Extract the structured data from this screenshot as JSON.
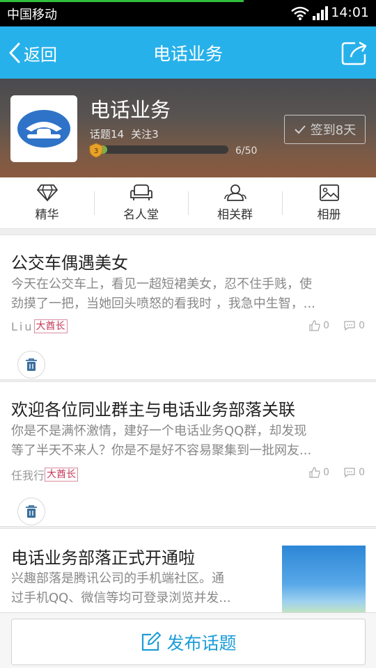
{
  "status_bar": {
    "carrier": "中国移动",
    "time": "14:01"
  },
  "nav": {
    "back_label": "返回",
    "title": "电话业务"
  },
  "header": {
    "name": "电话业务",
    "topics": "话题14",
    "follows": "关注3",
    "level": "3",
    "level_progress_text": "6/50",
    "level_progress": 0.12,
    "checkin_label": "签到8天"
  },
  "tabs": [
    {
      "label": "精华",
      "icon": "diamond-icon"
    },
    {
      "label": "名人堂",
      "icon": "sofa-icon"
    },
    {
      "label": "相关群",
      "icon": "group-icon"
    },
    {
      "label": "相册",
      "icon": "image-icon"
    }
  ],
  "posts": [
    {
      "title": "公交车偶遇美女",
      "body_line1": "今天在公交车上，看见一超短裙美女，忍不住手贱，使",
      "body_line2": "劲摸了一把，当她回头喷怒的看我时 ，我急中生智，...",
      "author": "Liu",
      "rank": "大酋长",
      "likes": "0",
      "comments": "0"
    },
    {
      "title": "欢迎各位同业群主与电话业务部落关联",
      "body_line1": "你是不是满怀激情，建好一个电话业务QQ群，却发现",
      "body_line2": "等了半天不来人？你是不是好不容易聚集到一批网友...",
      "author": "任我行",
      "rank": "大酋长",
      "likes": "0",
      "comments": "0"
    },
    {
      "title": "电话业务部落正式开通啦",
      "body_line1": "兴趣部落是腾讯公司的手机端社区。通",
      "body_line2": "过手机QQ、微信等均可登录浏览并发..."
    }
  ],
  "bottom": {
    "publish_label": "发布话题"
  },
  "colors": {
    "accent": "#27b1ea",
    "link": "#1b9cd8",
    "rank": "#c43a5a"
  }
}
